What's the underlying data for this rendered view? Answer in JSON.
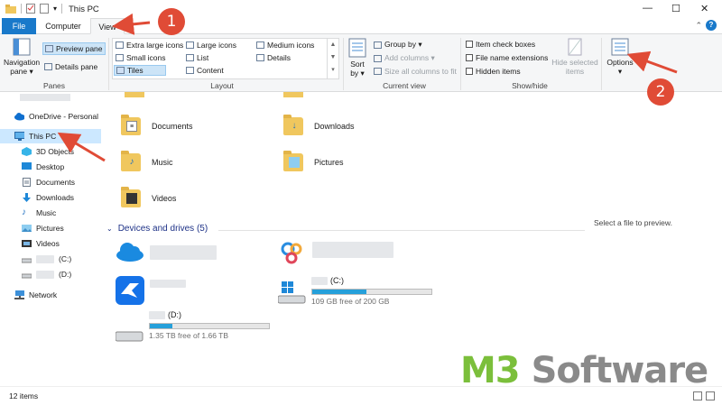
{
  "window": {
    "title": "This PC",
    "minimize": "—",
    "maximize": "☐",
    "close": "✕"
  },
  "tabs": {
    "file": "File",
    "computer": "Computer",
    "view": "View"
  },
  "ribbon": {
    "panes": {
      "label": "Panes",
      "navigation_pane": "Navigation pane ▾",
      "preview_pane": "Preview pane",
      "details_pane": "Details pane"
    },
    "layout": {
      "label": "Layout",
      "items": [
        "Extra large icons",
        "Large icons",
        "Medium icons",
        "Small icons",
        "List",
        "Details",
        "Tiles",
        "Content"
      ]
    },
    "current_view": {
      "label": "Current view",
      "sort_by": "Sort by ▾",
      "group_by": "Group by ▾",
      "add_columns": "Add columns ▾",
      "size_columns": "Size all columns to fit"
    },
    "show_hide": {
      "label": "Show/hide",
      "item_check_boxes": "Item check boxes",
      "file_name_extensions": "File name extensions",
      "hidden_items": "Hidden items",
      "hide_selected": "Hide selected items"
    },
    "options": "Options"
  },
  "nav": {
    "items": [
      {
        "label": "OneDrive - Personal",
        "icon": "cloud-icon"
      },
      {
        "label": "This PC",
        "icon": "computer-icon"
      },
      {
        "label": "3D Objects",
        "icon": "cube-icon"
      },
      {
        "label": "Desktop",
        "icon": "desktop-icon"
      },
      {
        "label": "Documents",
        "icon": "document-icon"
      },
      {
        "label": "Downloads",
        "icon": "download-icon"
      },
      {
        "label": "Music",
        "icon": "music-icon"
      },
      {
        "label": "Pictures",
        "icon": "picture-icon"
      },
      {
        "label": "Videos",
        "icon": "video-icon"
      },
      {
        "label": "(C:)",
        "icon": "drive-icon"
      },
      {
        "label": "(D:)",
        "icon": "drive-icon"
      },
      {
        "label": "Network",
        "icon": "network-icon"
      }
    ]
  },
  "folders": [
    "Documents",
    "Downloads",
    "Music",
    "Pictures",
    "Videos"
  ],
  "devices": {
    "header": "Devices and drives (5)",
    "drive_c": {
      "label": "(C:)",
      "free": "109 GB free of 200 GB",
      "used_fraction": 0.455
    },
    "drive_d": {
      "label": "(D:)",
      "free": "1.35 TB free of 1.66 TB",
      "used_fraction": 0.19
    }
  },
  "preview": {
    "empty_text": "Select a file to preview."
  },
  "status": {
    "items": "12 items"
  },
  "annotations": {
    "step1": "1",
    "step2": "2"
  },
  "watermark": {
    "m3": "M3",
    "software": " Software"
  },
  "colors": {
    "accent": "#1979ca",
    "arrow": "#e04b36",
    "bar_fill": "#26a0da"
  }
}
